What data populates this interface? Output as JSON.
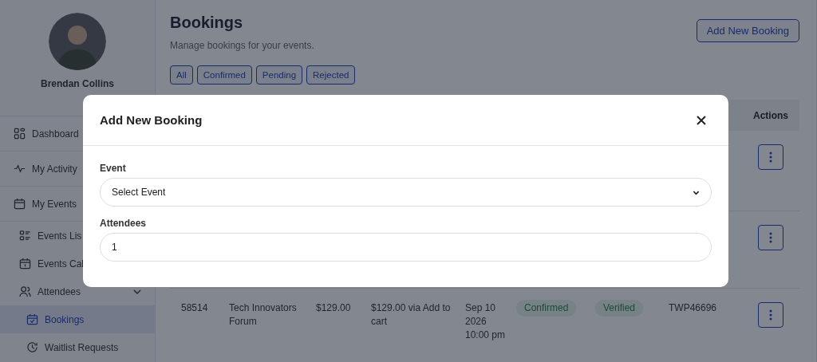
{
  "user": {
    "name": "Brendan Collins"
  },
  "sidebar": {
    "items": [
      {
        "label": "Dashboard",
        "selected": false
      },
      {
        "label": "My Activity",
        "selected": false
      },
      {
        "label": "My Events",
        "selected": false,
        "children": [
          {
            "label": "Events Lis",
            "selected": false
          },
          {
            "label": "Events Cal",
            "selected": false
          },
          {
            "label": "Attendees",
            "selected": false,
            "expanded": true,
            "children": [
              {
                "label": "Bookings",
                "selected": true
              },
              {
                "label": "Waitlist Requests",
                "selected": false
              }
            ]
          }
        ]
      }
    ]
  },
  "page": {
    "title": "Bookings",
    "subtitle": "Manage bookings for your events.",
    "add_button": "Add New Booking",
    "filters": [
      {
        "label": "All"
      },
      {
        "label": "Confirmed"
      },
      {
        "label": "Pending"
      },
      {
        "label": "Rejected"
      }
    ]
  },
  "table": {
    "columns": [
      {
        "label": "Actions"
      }
    ],
    "rows": [
      {
        "kind": "hidden"
      },
      {
        "kind": "hidden"
      },
      {
        "kind": "full",
        "booking_no": "58514",
        "event": "Tech Innovators Forum",
        "price": "$129.00",
        "payment": "$129.00 via Add to cart",
        "date": "Sep 10 2026 10:00 pm",
        "status": "Confirmed",
        "verification": "Verified",
        "ticket": "TWP46696"
      }
    ]
  },
  "modal": {
    "title": "Add New Booking",
    "fields": [
      {
        "kind": "select",
        "label": "Event",
        "value": "Select Event"
      },
      {
        "kind": "input",
        "label": "Attendees",
        "value": "1"
      }
    ]
  }
}
